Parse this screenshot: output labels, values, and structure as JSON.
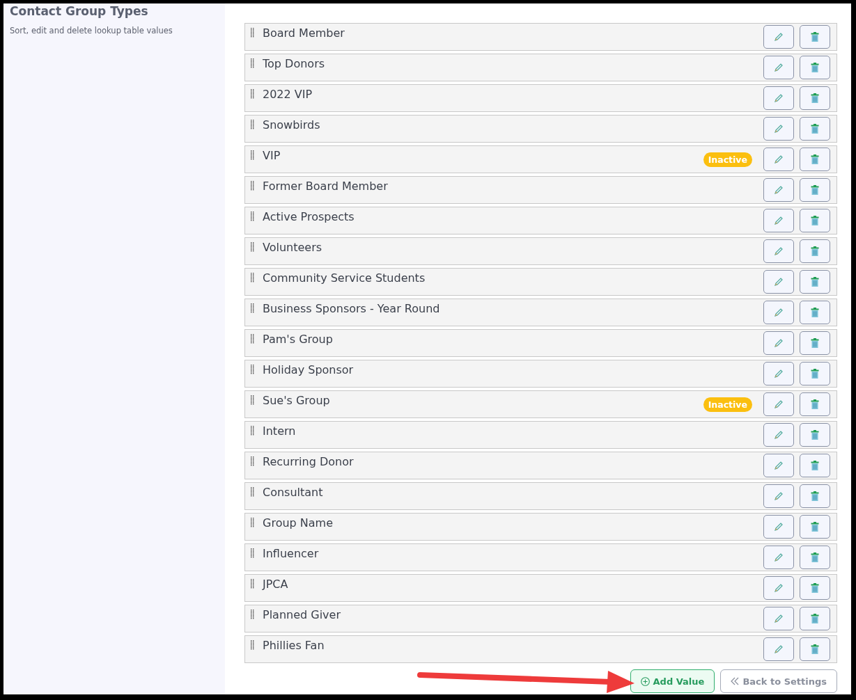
{
  "sidebar": {
    "title": "Contact Group Types",
    "subtitle": "Sort, edit and delete lookup table values"
  },
  "values": [
    {
      "label": "Board Member",
      "inactive": false
    },
    {
      "label": "Top Donors",
      "inactive": false
    },
    {
      "label": "2022 VIP",
      "inactive": false
    },
    {
      "label": "Snowbirds",
      "inactive": false
    },
    {
      "label": "VIP",
      "inactive": true,
      "badge": "Inactive"
    },
    {
      "label": "Former Board Member",
      "inactive": false
    },
    {
      "label": "Active Prospects",
      "inactive": false
    },
    {
      "label": "Volunteers",
      "inactive": false
    },
    {
      "label": "Community Service Students",
      "inactive": false
    },
    {
      "label": "Business Sponsors - Year Round",
      "inactive": false
    },
    {
      "label": "Pam's Group",
      "inactive": false
    },
    {
      "label": "Holiday Sponsor",
      "inactive": false
    },
    {
      "label": "Sue's Group",
      "inactive": true,
      "badge": "Inactive"
    },
    {
      "label": "Intern",
      "inactive": false
    },
    {
      "label": "Recurring Donor",
      "inactive": false
    },
    {
      "label": "Consultant",
      "inactive": false
    },
    {
      "label": "Group Name",
      "inactive": false
    },
    {
      "label": "Influencer",
      "inactive": false
    },
    {
      "label": "JPCA",
      "inactive": false
    },
    {
      "label": "Planned Giver",
      "inactive": false
    },
    {
      "label": "Phillies Fan",
      "inactive": false
    }
  ],
  "buttons": {
    "add": "Add Value",
    "back": "Back to Settings"
  }
}
